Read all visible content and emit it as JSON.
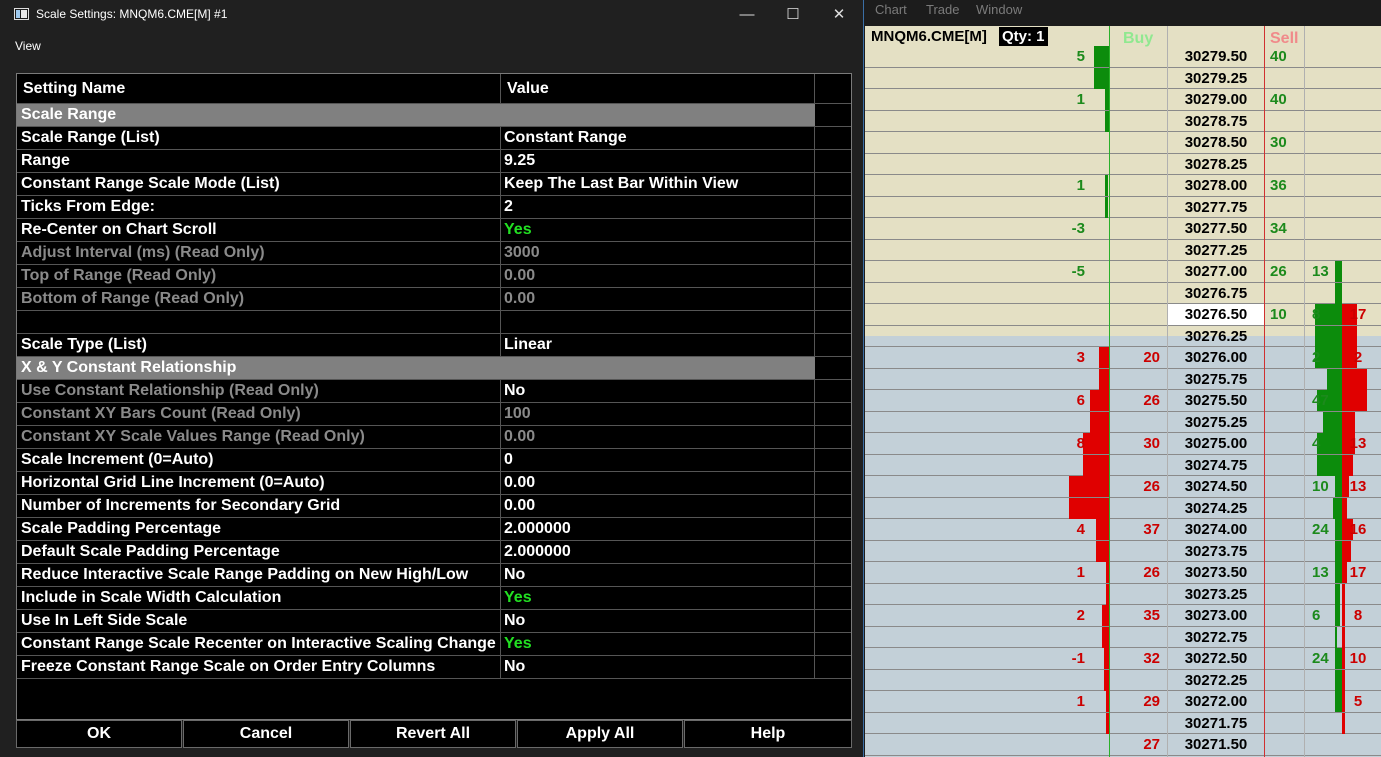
{
  "dialog": {
    "title": "Scale Settings: MNQM6.CME[M] #1",
    "menu_view": "View",
    "minimize": "—",
    "maximize": "☐",
    "close": "✕",
    "headers": {
      "name": "Setting Name",
      "value": "Value"
    },
    "rows": [
      {
        "name": "Scale Range",
        "value": "",
        "type": "section"
      },
      {
        "name": "Scale Range (List)",
        "value": "Constant Range",
        "type": "normal"
      },
      {
        "name": "Range",
        "value": "9.25",
        "type": "normal"
      },
      {
        "name": "Constant Range Scale Mode (List)",
        "value": "Keep The Last Bar Within View",
        "type": "normal"
      },
      {
        "name": "Ticks From Edge:",
        "value": "2",
        "type": "normal"
      },
      {
        "name": "Re-Center on Chart Scroll",
        "value": "Yes",
        "type": "normal",
        "green": true
      },
      {
        "name": "Adjust Interval (ms) (Read Only)",
        "value": "3000",
        "type": "ro"
      },
      {
        "name": "Top of Range (Read Only)",
        "value": "0.00",
        "type": "ro"
      },
      {
        "name": "Bottom of Range (Read Only)",
        "value": "0.00",
        "type": "ro"
      },
      {
        "name": "",
        "value": "",
        "type": "normal"
      },
      {
        "name": "Scale Type (List)",
        "value": "Linear",
        "type": "normal"
      },
      {
        "name": "X & Y Constant Relationship",
        "value": "",
        "type": "section"
      },
      {
        "name": "Use Constant Relationship (Read Only)",
        "value": "No",
        "type": "ro",
        "white_value": true
      },
      {
        "name": "Constant XY Bars Count (Read Only)",
        "value": "100",
        "type": "ro"
      },
      {
        "name": "Constant XY Scale Values Range (Read Only)",
        "value": "0.00",
        "type": "ro"
      },
      {
        "name": "Scale Increment (0=Auto)",
        "value": "0",
        "type": "normal"
      },
      {
        "name": "Horizontal Grid Line Increment (0=Auto)",
        "value": "0.00",
        "type": "normal"
      },
      {
        "name": "Number of Increments for Secondary Grid",
        "value": "0.00",
        "type": "normal"
      },
      {
        "name": "Scale Padding Percentage",
        "value": "2.000000",
        "type": "normal"
      },
      {
        "name": "Default Scale Padding Percentage",
        "value": "2.000000",
        "type": "normal"
      },
      {
        "name": "Reduce Interactive Scale Range Padding on New High/Low",
        "value": "No",
        "type": "normal"
      },
      {
        "name": "Include in Scale Width Calculation",
        "value": "Yes",
        "type": "normal",
        "green": true
      },
      {
        "name": "Use In Left Side Scale",
        "value": "No",
        "type": "normal"
      },
      {
        "name": "Constant Range Scale Recenter on Interactive Scaling Change",
        "value": "Yes",
        "type": "normal",
        "green": true
      },
      {
        "name": "Freeze Constant Range Scale on Order Entry Columns",
        "value": "No",
        "type": "normal"
      }
    ],
    "buttons": {
      "ok": "OK",
      "cancel": "Cancel",
      "revert": "Revert All",
      "apply": "Apply All",
      "help": "Help"
    }
  },
  "dom": {
    "menu": {
      "chart": "Chart",
      "trade": "Trade",
      "window": "Window"
    },
    "symbol": "MNQM6.CME[M]",
    "qty": "Qty: 1",
    "buy_label": "Buy",
    "sell_label": "Sell",
    "current_price": "30276.50",
    "rows": [
      {
        "price": "30279.50",
        "delta": "5",
        "dcolor": "green",
        "ask": "40"
      },
      {
        "price": "30279.25",
        "delta": "",
        "ask": ""
      },
      {
        "price": "30279.00",
        "delta": "1",
        "dcolor": "green",
        "ask": "40"
      },
      {
        "price": "30278.75",
        "delta": "",
        "ask": ""
      },
      {
        "price": "30278.50",
        "delta": "",
        "ask": "30"
      },
      {
        "price": "30278.25",
        "delta": "",
        "ask": ""
      },
      {
        "price": "30278.00",
        "delta": "1",
        "dcolor": "green",
        "ask": "36"
      },
      {
        "price": "30277.75",
        "delta": "",
        "ask": ""
      },
      {
        "price": "30277.50",
        "delta": "-3",
        "dcolor": "green",
        "ask": "34"
      },
      {
        "price": "30277.25",
        "delta": "",
        "ask": ""
      },
      {
        "price": "30277.00",
        "delta": "-5",
        "dcolor": "green",
        "ask": "26",
        "ask2": "13"
      },
      {
        "price": "30276.75",
        "delta": "",
        "ask": ""
      },
      {
        "price": "30276.50",
        "delta": "",
        "ask": "10",
        "ask2": "8",
        "sell": "17"
      },
      {
        "price": "30276.25",
        "delta": "",
        "ask": ""
      },
      {
        "price": "30276.00",
        "delta": "3",
        "dcolor": "red",
        "bid": "20",
        "ask2": "2",
        "sell": "2"
      },
      {
        "price": "30275.75",
        "delta": "",
        "bid": ""
      },
      {
        "price": "30275.50",
        "delta": "6",
        "dcolor": "red",
        "bid": "26",
        "ask2": "47"
      },
      {
        "price": "30275.25",
        "delta": "",
        "bid": ""
      },
      {
        "price": "30275.00",
        "delta": "8",
        "dcolor": "red",
        "bid": "30",
        "ask2": "4",
        "sell": "13"
      },
      {
        "price": "30274.75",
        "delta": "",
        "bid": ""
      },
      {
        "price": "30274.50",
        "delta": "",
        "bid": "26",
        "ask2": "10",
        "sell": "13"
      },
      {
        "price": "30274.25",
        "delta": "",
        "bid": ""
      },
      {
        "price": "30274.00",
        "delta": "4",
        "dcolor": "red",
        "bid": "37",
        "ask2": "24",
        "sell": "16"
      },
      {
        "price": "30273.75",
        "delta": "",
        "bid": ""
      },
      {
        "price": "30273.50",
        "delta": "1",
        "dcolor": "red",
        "bid": "26",
        "ask2": "13",
        "sell": "17"
      },
      {
        "price": "30273.25",
        "delta": "",
        "bid": ""
      },
      {
        "price": "30273.00",
        "delta": "2",
        "dcolor": "red",
        "bid": "35",
        "ask2": "6",
        "sell": "8"
      },
      {
        "price": "30272.75",
        "delta": "",
        "bid": ""
      },
      {
        "price": "30272.50",
        "delta": "-1",
        "dcolor": "red",
        "bid": "32",
        "ask2": "24",
        "sell": "10"
      },
      {
        "price": "30272.25",
        "delta": "",
        "bid": ""
      },
      {
        "price": "30272.00",
        "delta": "1",
        "dcolor": "red",
        "bid": "29",
        "sell": "5"
      },
      {
        "price": "30271.75",
        "delta": "",
        "bid": ""
      },
      {
        "price": "30271.50",
        "delta": "",
        "bid": "27"
      }
    ]
  }
}
